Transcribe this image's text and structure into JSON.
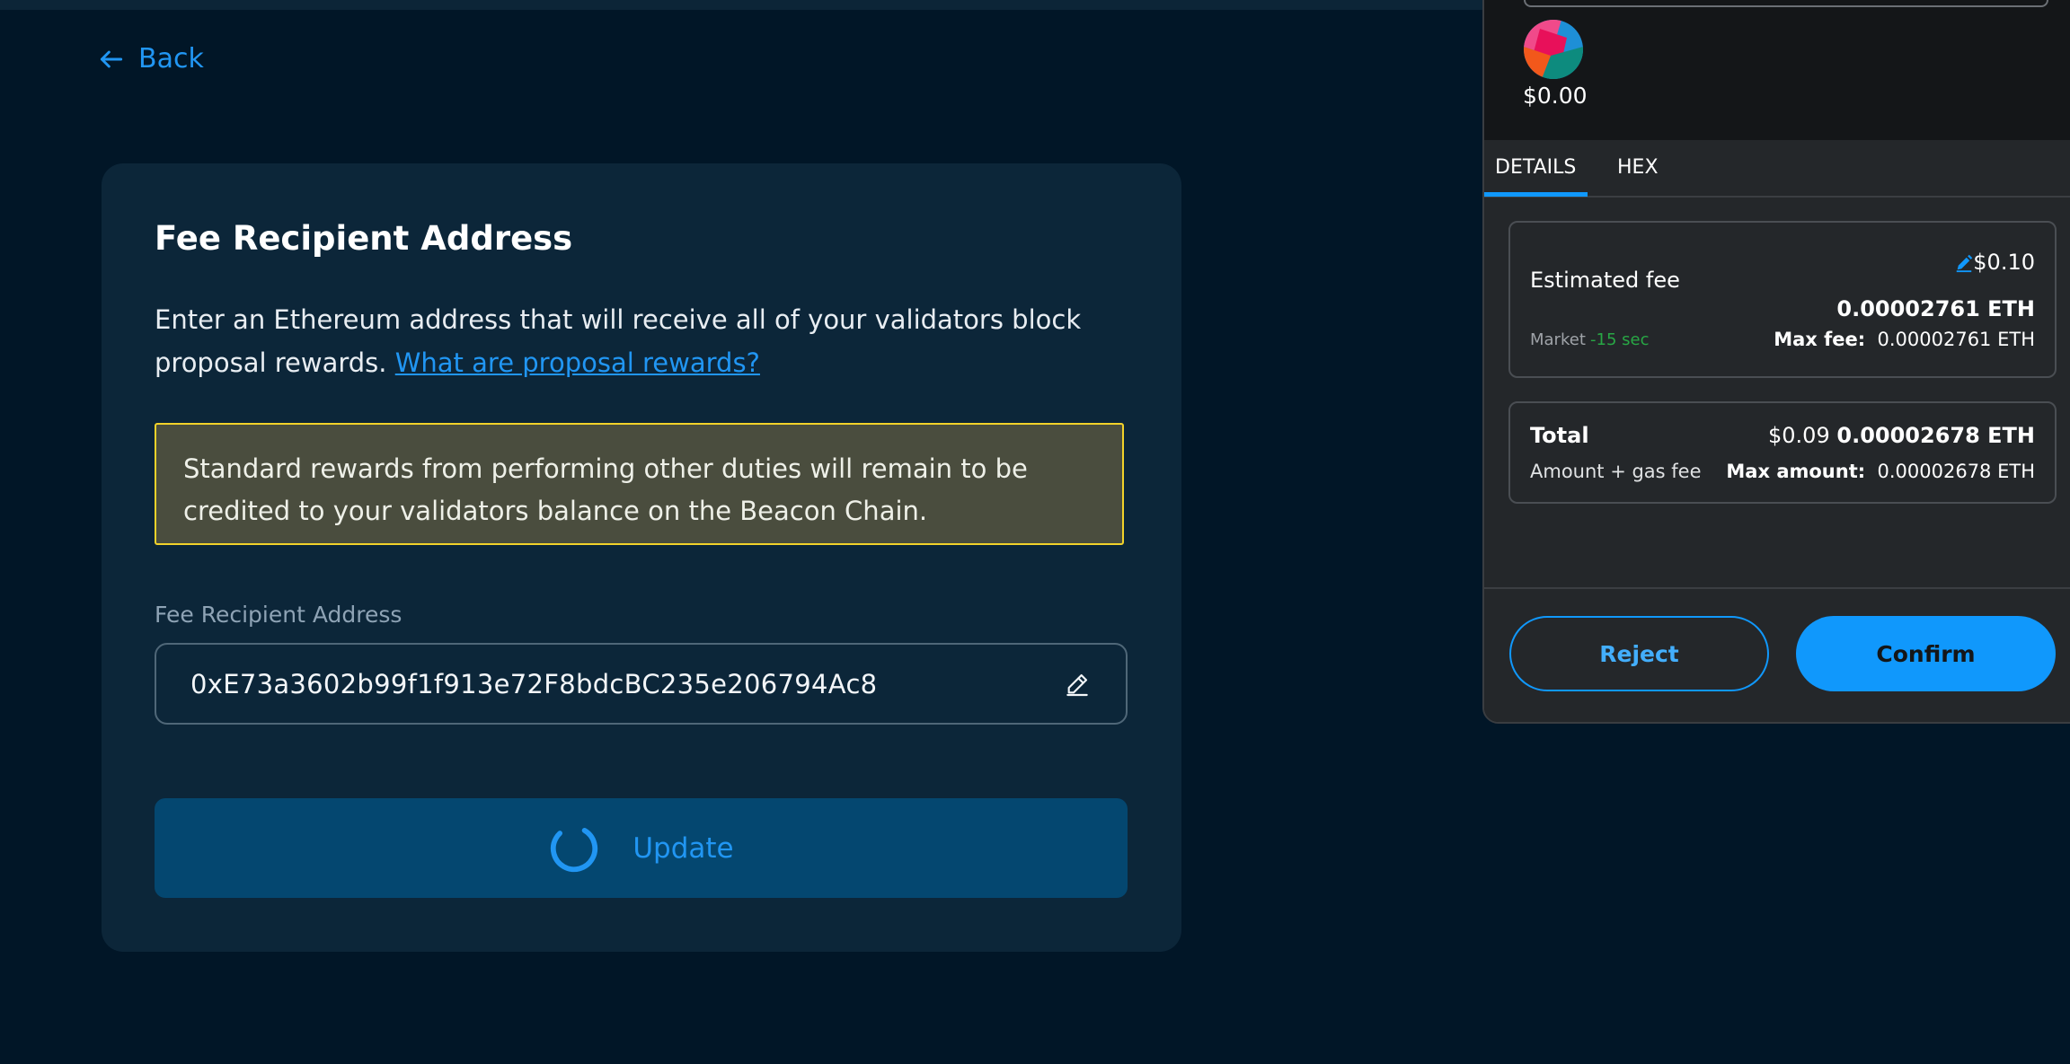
{
  "nav": {
    "back_label": "Back"
  },
  "card": {
    "title": "Fee Recipient Address",
    "description": "Enter an Ethereum address that will receive all of your validators block proposal rewards.",
    "link_text": "What are proposal rewards?",
    "notice": "Standard rewards from performing other duties will remain to be credited to your validators balance on the Beacon Chain.",
    "field_label": "Fee Recipient Address",
    "field_value": "0xE73a3602b99f1f913e72F8bdcBC235e206794Ac8",
    "update_label": "Update"
  },
  "wallet": {
    "token_value": "$0.00",
    "tabs": [
      "DETAILS",
      "HEX"
    ],
    "active_tab": "DETAILS",
    "fee": {
      "label": "Estimated fee",
      "usd": "$0.10",
      "eth": "0.00002761 ETH",
      "market": "Market",
      "time": "-15 sec",
      "max_label": "Max fee:",
      "max_value": "0.00002761 ETH"
    },
    "total": {
      "label": "Total",
      "sub_label": "Amount + gas fee",
      "usd": "$0.09",
      "eth": "0.00002678 ETH",
      "max_label": "Max amount:",
      "max_value": "0.00002678 ETH"
    },
    "reject_label": "Reject",
    "confirm_label": "Confirm"
  },
  "colors": {
    "background": "#011627",
    "card": "#0c2639",
    "accent": "#2196f3",
    "notice_border": "#f2d22a",
    "wallet_accent": "#1098fc",
    "success": "#28a745"
  },
  "icons": [
    "arrow-left-icon",
    "pencil-icon",
    "spinner-icon",
    "token-avatar-icon",
    "edit-fee-icon"
  ]
}
